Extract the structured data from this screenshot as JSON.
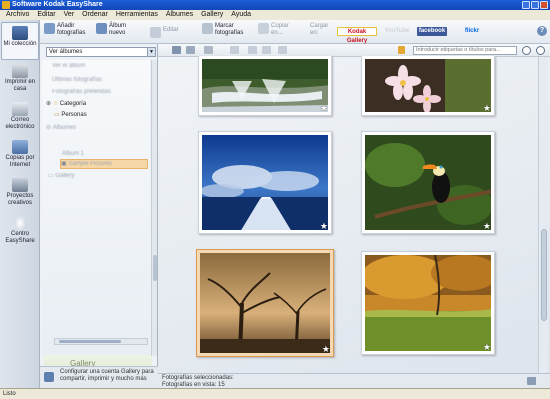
{
  "window": {
    "title": "Software Kodak EasyShare"
  },
  "menu": [
    "Archivo",
    "Editar",
    "Ver",
    "Ordenar",
    "Herramientas",
    "Álbumes",
    "Gallery",
    "Ayuda"
  ],
  "nav": [
    {
      "label": "Mi colección",
      "icon": "my-collection-icon"
    },
    {
      "label": "Imprimir en casa",
      "icon": "printer-icon"
    },
    {
      "label": "Correo electrónico",
      "icon": "email-icon"
    },
    {
      "label": "Copias por Internet",
      "icon": "online-prints-icon"
    },
    {
      "label": "Proyectos creativos",
      "icon": "creative-projects-icon"
    },
    {
      "label": "Centro EasyShare",
      "icon": "lightbulb-icon"
    }
  ],
  "toolbar": {
    "add_photos": "Añadir fotografías",
    "new_album": "Álbum nuevo",
    "edit": "Editar",
    "tag_photos": "Marcar fotografías",
    "copy_to": "Copiar en...",
    "upload_to": "Cargar en:",
    "brands": [
      "Kodak Gallery",
      "YouTube",
      "facebook",
      "flickr"
    ]
  },
  "leftpanel": {
    "album_select": "Ver álbumes",
    "tree_blurred": [
      "Ver el álbum",
      "Últimas fotografías",
      "Fotografías preferidas"
    ],
    "categoria": "Categoría",
    "personas": "Personas",
    "albums_node": "Álbumes",
    "album_child": "Álbum 1",
    "sample_album": "Sample Pictures",
    "gallery_node": "Gallery",
    "gallery_banner": "Gallery",
    "promo": "Configurar una cuenta Gallery para compartir, imprimir y mucho más"
  },
  "main": {
    "search_placeholder": "Introducir etiquetas o títulos para...",
    "selected_label": "Fotografías seleccionadas:",
    "in_view_label": "Fotografías en vista:",
    "in_view_count": "15"
  },
  "photos": [
    {
      "name": "waterfall",
      "selected": false
    },
    {
      "name": "frangipani-flowers",
      "selected": false
    },
    {
      "name": "pier-sunset",
      "selected": false
    },
    {
      "name": "toucan",
      "selected": false
    },
    {
      "name": "autumn-trees",
      "selected": true
    },
    {
      "name": "autumn-meadow",
      "selected": false
    }
  ],
  "status": {
    "text": "Listo"
  },
  "colors": {
    "title": "#1c5fd8",
    "selection": "#f4d9b4",
    "accent": "#e6b470"
  }
}
